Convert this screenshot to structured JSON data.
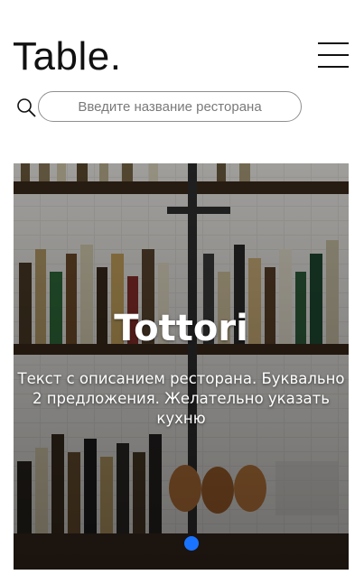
{
  "header": {
    "logo_text": "Table.",
    "menu_icon": "hamburger-menu-icon"
  },
  "search": {
    "icon": "search-icon",
    "placeholder": "Введите название ресторана",
    "value": ""
  },
  "carousel": {
    "slide": {
      "title": "Tottori",
      "description": "Текст с описанием ресторана. Буквально 2 предложения. Желательно указать кухню"
    },
    "active_dot_color": "#1a73ff",
    "dots_count": 1,
    "active_index": 0
  }
}
